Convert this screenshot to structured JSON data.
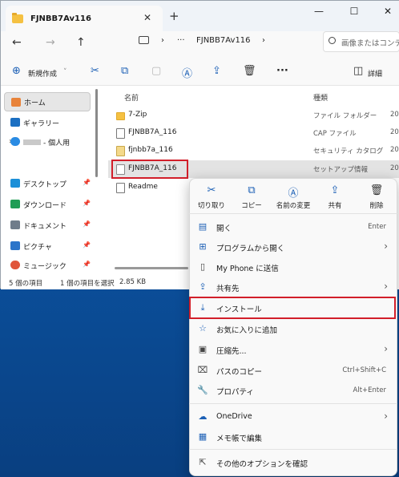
{
  "window": {
    "tab_title": "FJNBB7Av116",
    "tab_close": "✕",
    "tab_add": "+",
    "minimize": "—",
    "maximize": "☐",
    "close": "✕"
  },
  "address": {
    "back": "←",
    "forward": "→",
    "up": "↑",
    "separator1": "›",
    "more": "···",
    "path_item": "FJNBB7Av116",
    "separator2": "›",
    "search_placeholder": "画像またはコンテンツの検索"
  },
  "toolbar": {
    "new_label": "新規作成",
    "new_caret": "˅",
    "view_label": "詳細"
  },
  "sidebar": {
    "items": [
      {
        "label": "ホーム",
        "color": "#e8833a"
      },
      {
        "label": "ギャラリー",
        "color": "#1b6fc2"
      },
      {
        "label": "- 個人用",
        "color": "#2a8be3"
      },
      {
        "label": "デスクトップ",
        "color": "#1b8fd8"
      },
      {
        "label": "ダウンロード",
        "color": "#1f9d55"
      },
      {
        "label": "ドキュメント",
        "color": "#6f7c8a"
      },
      {
        "label": "ピクチャ",
        "color": "#2b74c9"
      },
      {
        "label": "ミュージック",
        "color": "#e0553a"
      }
    ],
    "pin": "📌",
    "expand": "›"
  },
  "columns": {
    "name": "名前",
    "type": "種類"
  },
  "files": [
    {
      "name": "7-Zip",
      "type": "ファイル フォルダー",
      "date": "20"
    },
    {
      "name": "FJNBB7A_116",
      "type": "CAP ファイル",
      "date": "20"
    },
    {
      "name": "fjnbb7a_116",
      "type": "セキュリティ カタログ",
      "date": "20"
    },
    {
      "name": "FJNBB7A_116",
      "type": "セットアップ情報",
      "date": "20"
    },
    {
      "name": "Readme",
      "type": "",
      "date": ""
    }
  ],
  "status": {
    "count": "5 個の項目",
    "selected": "1 個の項目を選択",
    "size": "2.85 KB"
  },
  "context_menu": {
    "quick_actions": [
      {
        "icon": "✂",
        "label": "切り取り"
      },
      {
        "icon": "⧉",
        "label": "コピー"
      },
      {
        "icon": "Ⓐ",
        "label": "名前の変更"
      },
      {
        "icon": "⇪",
        "label": "共有"
      },
      {
        "icon": "🗑",
        "label": "削除"
      }
    ],
    "items": [
      {
        "icon": "▤",
        "label": "開く",
        "shortcut": "Enter",
        "arrow": ""
      },
      {
        "icon": "⊞",
        "label": "プログラムから開く",
        "shortcut": "",
        "arrow": "›"
      },
      {
        "icon": "▯",
        "label": "My Phone に送信",
        "shortcut": "",
        "arrow": ""
      },
      {
        "icon": "⇪",
        "label": "共有先",
        "shortcut": "",
        "arrow": "›"
      },
      {
        "icon": "⤓",
        "label": "インストール",
        "shortcut": "",
        "arrow": ""
      },
      {
        "icon": "☆",
        "label": "お気に入りに追加",
        "shortcut": "",
        "arrow": ""
      },
      {
        "icon": "▣",
        "label": "圧縮先...",
        "shortcut": "",
        "arrow": "›"
      },
      {
        "icon": "⌧",
        "label": "パスのコピー",
        "shortcut": "Ctrl+Shift+C",
        "arrow": ""
      },
      {
        "icon": "🔧",
        "label": "プロパティ",
        "shortcut": "Alt+Enter",
        "arrow": ""
      },
      {
        "icon": "☁",
        "label": "OneDrive",
        "shortcut": "",
        "arrow": "›"
      },
      {
        "icon": "▦",
        "label": "メモ帳で編集",
        "shortcut": "",
        "arrow": ""
      },
      {
        "icon": "⇱",
        "label": "その他のオプションを確認",
        "shortcut": "",
        "arrow": ""
      }
    ]
  },
  "colors": {
    "accent": "#1b5fb5",
    "highlight": "#d21f2a",
    "selection": "#e3e3e3"
  }
}
